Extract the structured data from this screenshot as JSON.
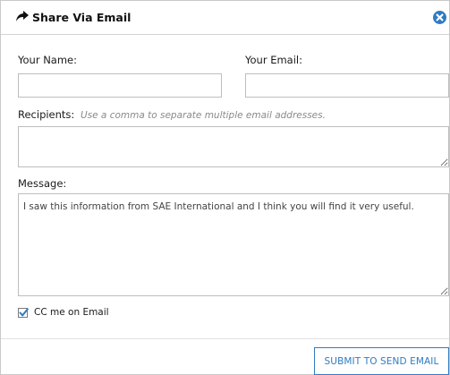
{
  "dialog": {
    "title": "Share Via Email",
    "title_icon": "share-arrow-icon",
    "close_icon": "close-circle-icon"
  },
  "form": {
    "your_name_label": "Your Name:",
    "your_name_value": "",
    "your_email_label": "Your Email:",
    "your_email_value": "",
    "recipients_label": "Recipients:",
    "recipients_hint": "Use a comma to separate multiple email addresses.",
    "recipients_value": "",
    "message_label": "Message:",
    "message_value": "I saw this information from SAE International and I think you will find it very useful.",
    "cc_label": "CC me on Email",
    "cc_checked": true,
    "submit_label": "SUBMIT TO SEND EMAIL"
  },
  "colors": {
    "accent": "#2f7bc1",
    "border": "#bdbdbd"
  }
}
